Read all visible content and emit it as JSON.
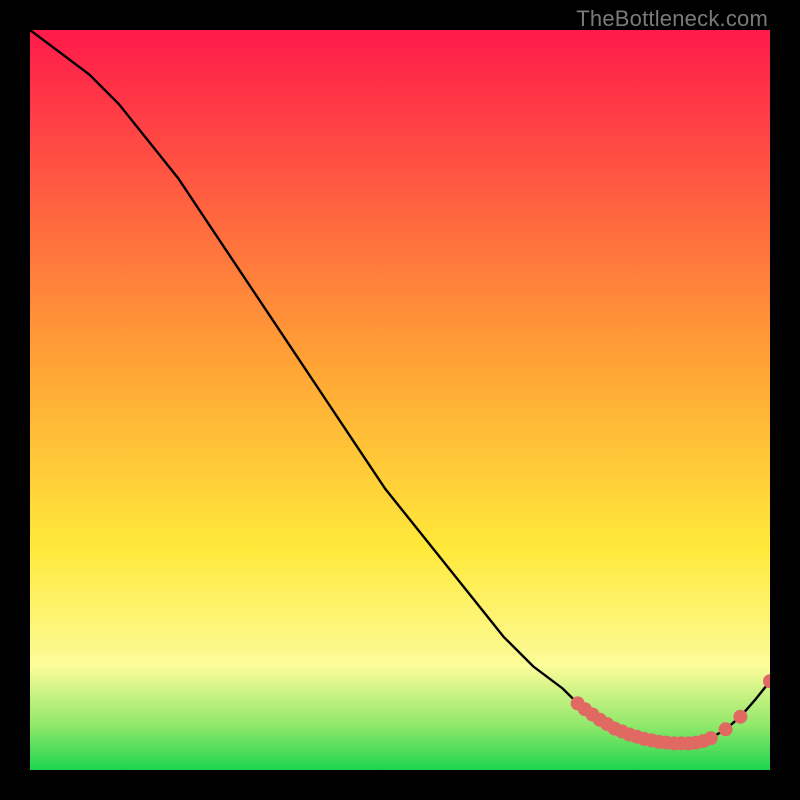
{
  "watermark": "TheBottleneck.com",
  "colors": {
    "bg": "#000000",
    "grad_top": "#ff1a4b",
    "grad_mid_orange": "#ffa335",
    "grad_yellow": "#ffe93a",
    "grad_pale_yellow": "#fcfc9a",
    "grad_green_light": "#8fe86a",
    "grad_green": "#1dd44e",
    "curve_stroke": "#000000",
    "marker_fill": "#e06a62",
    "marker_stroke": "#e06a62"
  },
  "chart_data": {
    "type": "line",
    "title": "",
    "xlabel": "",
    "ylabel": "",
    "xlim": [
      0,
      100
    ],
    "ylim": [
      0,
      100
    ],
    "series": [
      {
        "name": "bottleneck-curve",
        "x": [
          0,
          4,
          8,
          12,
          16,
          20,
          24,
          28,
          32,
          36,
          40,
          44,
          48,
          52,
          56,
          60,
          64,
          68,
          72,
          74,
          76,
          78,
          80,
          82,
          84,
          86,
          88,
          90,
          92,
          94,
          96,
          98,
          100
        ],
        "y": [
          100,
          97,
          94,
          90,
          85,
          80,
          74,
          68,
          62,
          56,
          50,
          44,
          38,
          33,
          28,
          23,
          18,
          14,
          11,
          9,
          7.5,
          6.2,
          5.2,
          4.5,
          4.0,
          3.7,
          3.6,
          3.7,
          4.3,
          5.5,
          7.2,
          9.5,
          12
        ]
      }
    ],
    "markers": {
      "name": "highlighted-range",
      "x": [
        74,
        75,
        76,
        77,
        78,
        79,
        80,
        81,
        82,
        83,
        84,
        85,
        86,
        87,
        88,
        89,
        90,
        91,
        92,
        94,
        96,
        100
      ],
      "y": [
        9.0,
        8.2,
        7.5,
        6.8,
        6.2,
        5.6,
        5.2,
        4.8,
        4.5,
        4.2,
        4.0,
        3.8,
        3.7,
        3.6,
        3.6,
        3.6,
        3.7,
        3.9,
        4.3,
        5.5,
        7.2,
        12
      ]
    }
  }
}
